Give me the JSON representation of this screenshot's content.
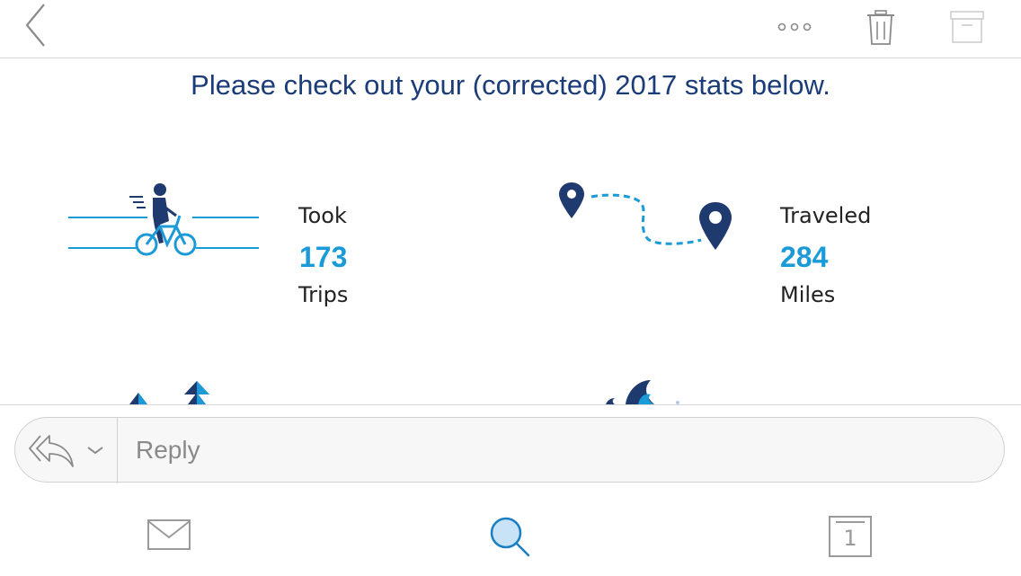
{
  "toolbar": {
    "back_icon": "chevron-left-icon",
    "more_icon": "more-dots-icon",
    "delete_icon": "trash-icon",
    "archive_icon": "archive-icon"
  },
  "message": {
    "headline": "Please check out your (corrected) 2017 stats below.",
    "stats": [
      {
        "label_top": "Took",
        "value": "173",
        "label_bottom": "Trips",
        "icon": "bike-rider-icon"
      },
      {
        "label_top": "Traveled",
        "value": "284",
        "label_bottom": "Miles",
        "icon": "route-map-icon"
      }
    ]
  },
  "reply": {
    "placeholder": "Reply",
    "reply_icon": "reply-all-icon",
    "dropdown_icon": "chevron-down-icon"
  },
  "tabbar": {
    "items": [
      {
        "icon": "mail-icon",
        "active": false
      },
      {
        "icon": "search-icon",
        "active": true
      },
      {
        "icon": "calendar-icon",
        "active": false,
        "day": "1"
      }
    ]
  },
  "colors": {
    "headline": "#1a3c78",
    "accent_blue": "#1b9ad8",
    "navy": "#1f3a6e",
    "icon_gray": "#9a9a9a"
  }
}
